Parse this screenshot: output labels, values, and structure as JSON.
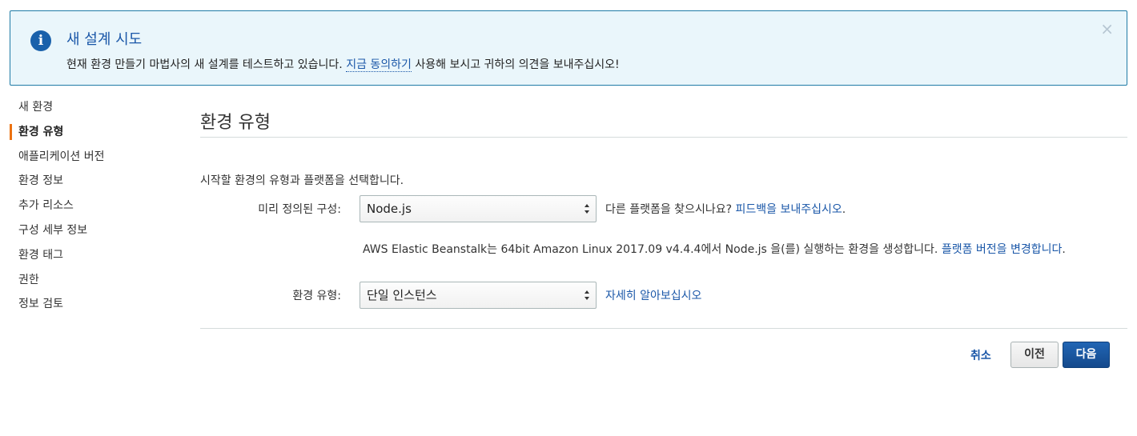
{
  "banner": {
    "title": "새 설계 시도",
    "message_before": "현재 환경 만들기 마법사의 새 설계를 테스트하고 있습니다.",
    "message_link": "지금 동의하기",
    "message_after": "사용해 보시고 귀하의 의견을 보내주십시오!",
    "close_glyph": "×",
    "info_glyph": "i"
  },
  "sidebar": {
    "items": [
      {
        "label": "새 환경",
        "active": false
      },
      {
        "label": "환경 유형",
        "active": true
      },
      {
        "label": "애플리케이션 버전",
        "active": false
      },
      {
        "label": "환경 정보",
        "active": false
      },
      {
        "label": "추가 리소스",
        "active": false
      },
      {
        "label": "구성 세부 정보",
        "active": false
      },
      {
        "label": "환경 태그",
        "active": false
      },
      {
        "label": "권한",
        "active": false
      },
      {
        "label": "정보 검토",
        "active": false
      }
    ]
  },
  "main": {
    "title": "환경 유형",
    "description": "시작할 환경의 유형과 플랫폼을 선택합니다.",
    "platform": {
      "label": "미리 정의된 구성:",
      "value": "Node.js",
      "hint_text": "다른 플랫폼을 찾으시나요?",
      "hint_link": "피드백을 보내주십시오",
      "hint_suffix": ".",
      "info_text": "AWS Elastic Beanstalk는 64bit Amazon Linux 2017.09 v4.4.4에서 Node.js 을(를) 실행하는 환경을 생성합니다.",
      "info_link": "플랫폼 버전을 변경합니다",
      "info_suffix": "."
    },
    "env_type": {
      "label": "환경 유형:",
      "value": "단일 인스턴스",
      "link": "자세히 알아보십시오"
    }
  },
  "footer": {
    "cancel_label": "취소",
    "prev_label": "이전",
    "next_label": "다음"
  }
}
